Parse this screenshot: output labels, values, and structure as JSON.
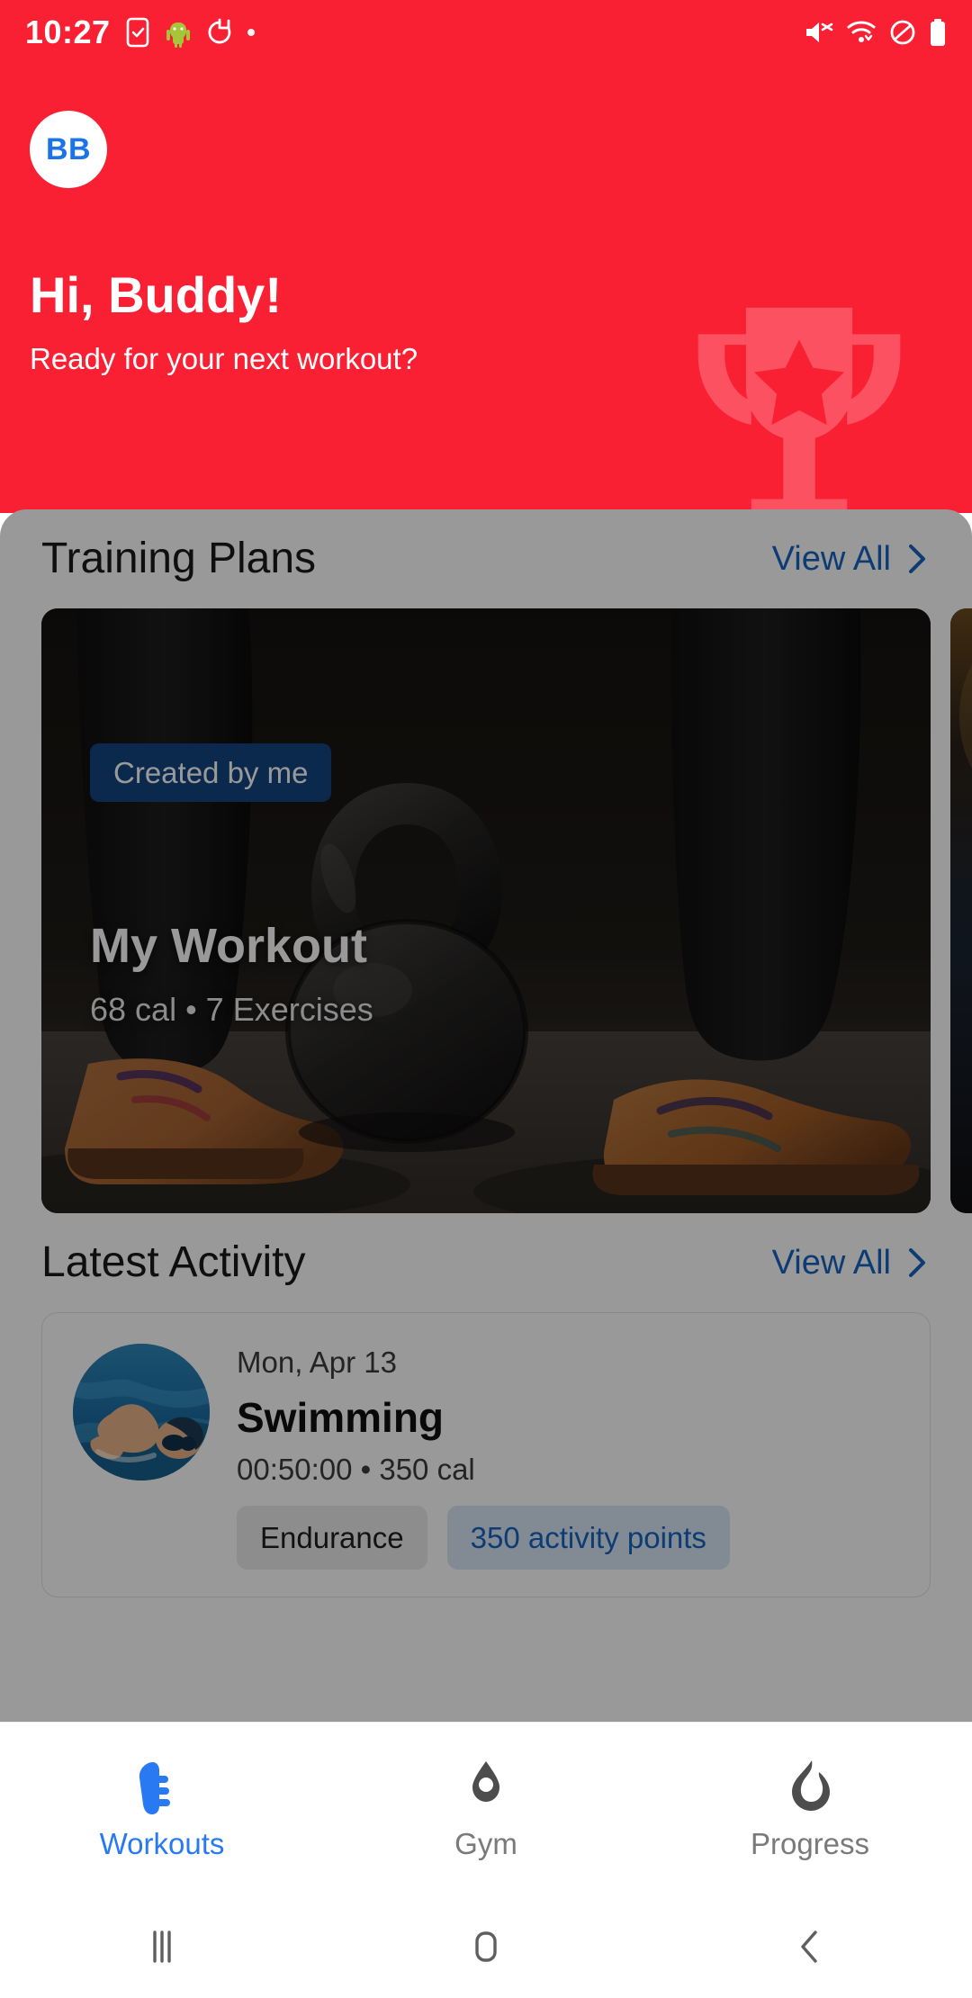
{
  "statusbar": {
    "time": "10:27",
    "left_icons": [
      "task-check-icon",
      "android-mascot-icon",
      "timer-reset-icon",
      "dot-indicator"
    ],
    "right_icons": [
      "mute-icon",
      "wifi-icon",
      "dnd-icon",
      "battery-icon"
    ]
  },
  "header": {
    "avatar_initials": "BB",
    "greeting": "Hi, Buddy!",
    "subgreeting": "Ready for your next workout?",
    "watermark_icon": "trophy-icon",
    "background_color": "#fa2033"
  },
  "training_plans": {
    "title": "Training Plans",
    "view_all_label": "View All",
    "cards": [
      {
        "badge": "Created by me",
        "title": "My Workout",
        "meta": "68 cal • 7 Exercises",
        "image": "kettlebell-photo"
      },
      {
        "badge": "",
        "title": "",
        "meta": "",
        "image": "gym-photo"
      }
    ]
  },
  "latest_activity": {
    "title": "Latest Activity",
    "view_all_label": "View All",
    "items": [
      {
        "date": "Mon, Apr 13",
        "name": "Swimming",
        "meta": "00:50:00 • 350 cal",
        "thumbnail": "swimmer-photo",
        "tags": [
          "Endurance",
          "350 activity points"
        ]
      }
    ]
  },
  "bottom_nav": {
    "active_color": "#2979f2",
    "inactive_color": "#7a7a7a",
    "items": [
      {
        "label": "Workouts",
        "icon": "running-shoe-icon",
        "active": true
      },
      {
        "label": "Gym",
        "icon": "location-pin-icon",
        "active": false
      },
      {
        "label": "Progress",
        "icon": "flame-icon",
        "active": false
      }
    ]
  },
  "system_nav": {
    "items": [
      {
        "icon": "recents-icon"
      },
      {
        "icon": "home-icon"
      },
      {
        "icon": "back-icon"
      }
    ]
  }
}
